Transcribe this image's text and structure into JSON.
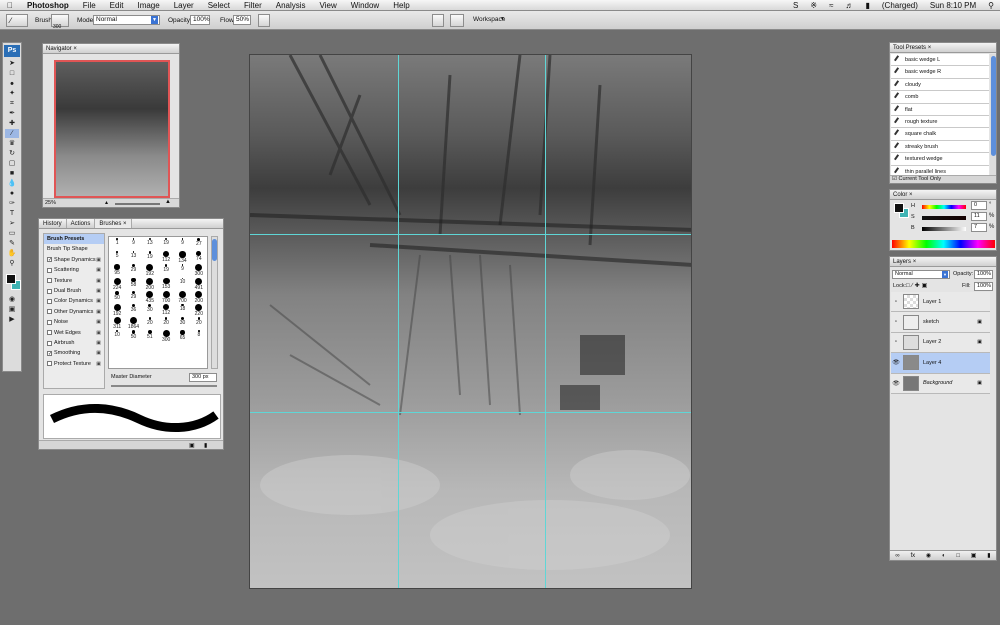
{
  "menubar": {
    "app": "Photoshop",
    "items": [
      "File",
      "Edit",
      "Image",
      "Layer",
      "Select",
      "Filter",
      "Analysis",
      "View",
      "Window",
      "Help"
    ],
    "status": "(Charged)",
    "clock": "Sun 8:10 PM"
  },
  "options": {
    "brush_label": "Brush:",
    "brush_size": "300",
    "mode_label": "Mode:",
    "mode_value": "Normal",
    "opacity_label": "Opacity:",
    "opacity_value": "100%",
    "flow_label": "Flow:",
    "flow_value": "50%",
    "workspace_label": "Workspace"
  },
  "toolbox": {
    "logo": "Ps",
    "tools": [
      "move-icon",
      "marquee-icon",
      "lasso-icon",
      "magic-wand-icon",
      "crop-icon",
      "eyedropper-icon",
      "healing-icon",
      "brush-icon",
      "stamp-icon",
      "history-brush-icon",
      "eraser-icon",
      "gradient-icon",
      "blur-icon",
      "dodge-icon",
      "pen-icon",
      "type-icon",
      "path-select-icon",
      "shape-icon",
      "notes-icon",
      "hand-icon",
      "zoom-icon"
    ]
  },
  "navigator": {
    "title": "Navigator",
    "zoom": "25%"
  },
  "brushes_panel": {
    "tabs": [
      "History",
      "Actions",
      "Brushes"
    ],
    "presets_label": "Brush Presets",
    "options": [
      {
        "label": "Brush Tip Shape",
        "checked": false,
        "has_box": false
      },
      {
        "label": "Shape Dynamics",
        "checked": true,
        "has_box": true
      },
      {
        "label": "Scattering",
        "checked": false,
        "has_box": true
      },
      {
        "label": "Texture",
        "checked": false,
        "has_box": true
      },
      {
        "label": "Dual Brush",
        "checked": false,
        "has_box": true
      },
      {
        "label": "Color Dynamics",
        "checked": false,
        "has_box": true
      },
      {
        "label": "Other Dynamics",
        "checked": false,
        "has_box": true
      },
      {
        "label": "Noise",
        "checked": false,
        "has_box": true
      },
      {
        "label": "Wet Edges",
        "checked": false,
        "has_box": true
      },
      {
        "label": "Airbrush",
        "checked": false,
        "has_box": true
      },
      {
        "label": "Smoothing",
        "checked": true,
        "has_box": true
      },
      {
        "label": "Protect Texture",
        "checked": false,
        "has_box": true
      }
    ],
    "brush_sizes": [
      "1",
      "9",
      "13",
      "19",
      "9",
      "27",
      "5",
      "13",
      "19",
      "112",
      "134",
      "74",
      "95",
      "29",
      "192",
      "19",
      "9",
      "300",
      "224",
      "58",
      "200",
      "153",
      "10",
      "491",
      "50",
      "29",
      "435",
      "700",
      "700",
      "200",
      "192",
      "36",
      "30",
      "112",
      "18",
      "220",
      "311",
      "1864",
      "20",
      "20",
      "30",
      "20",
      "10",
      "50",
      "51",
      "300",
      "65",
      "8"
    ],
    "master_diameter_label": "Master Diameter",
    "master_diameter_value": "300 px"
  },
  "tool_presets": {
    "title": "Tool Presets",
    "items": [
      "basic wedge L",
      "basic wedge R",
      "cloudy",
      "comb",
      "flat",
      "rough texture",
      "square chalk",
      "streaky brush",
      "textured wedge",
      "thin parallel lines"
    ],
    "current_only_label": "Current Tool Only"
  },
  "color_panel": {
    "title": "Color",
    "h_label": "H",
    "h_value": "0",
    "s_label": "S",
    "s_value": "11",
    "b_label": "B",
    "b_value": "7",
    "unit": "%",
    "deg": "°"
  },
  "layers_panel": {
    "title": "Layers",
    "mode": "Normal",
    "opacity_label": "Opacity:",
    "opacity_value": "100%",
    "lock_label": "Lock:",
    "fill_label": "Fill:",
    "fill_value": "100%",
    "layers": [
      {
        "name": "Layer 1",
        "visible": false,
        "selected": false,
        "locked": false
      },
      {
        "name": "sketch",
        "visible": false,
        "selected": false,
        "locked": true
      },
      {
        "name": "Layer 2",
        "visible": false,
        "selected": false,
        "locked": true
      },
      {
        "name": "Layer 4",
        "visible": true,
        "selected": true,
        "locked": false
      },
      {
        "name": "Background",
        "visible": true,
        "selected": false,
        "locked": true
      }
    ]
  }
}
